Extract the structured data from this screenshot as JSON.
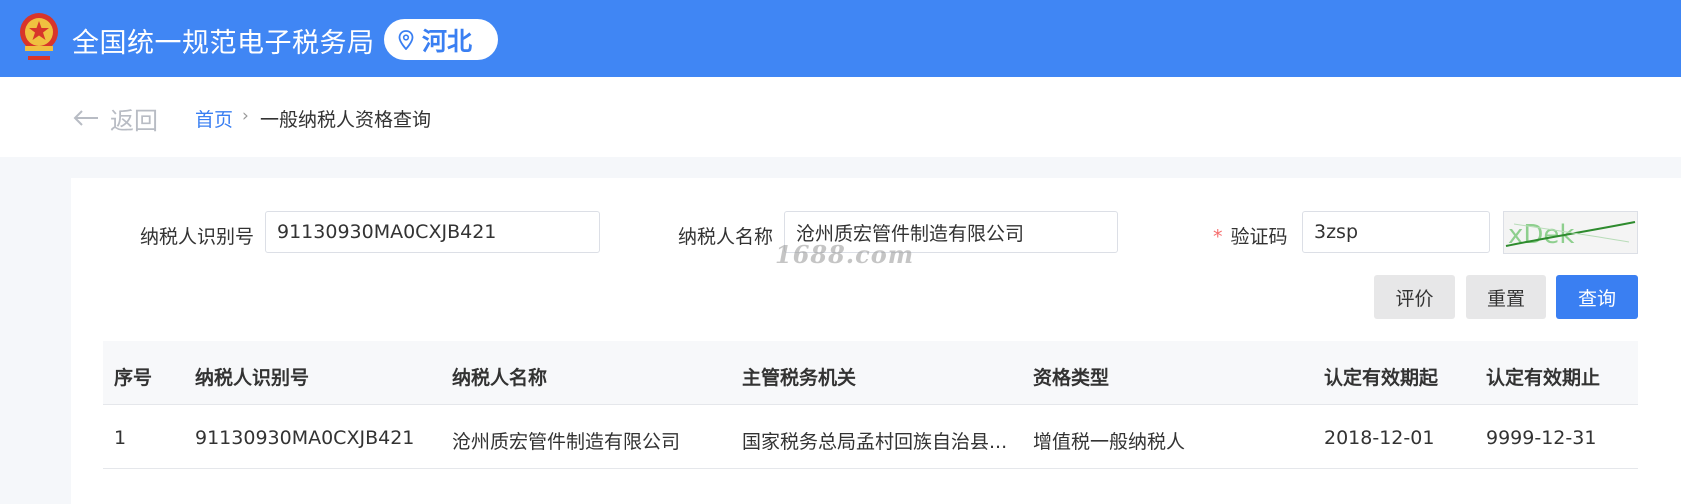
{
  "header": {
    "site_title": "全国统一规范电子税务局",
    "region": "河北",
    "colors": {
      "bar": "#4086f4",
      "accent": "#3a7ff2"
    }
  },
  "nav": {
    "back_label": "返回",
    "breadcrumb": [
      {
        "label": "首页"
      },
      {
        "label": "一般纳税人资格查询"
      }
    ],
    "separator": "›"
  },
  "form": {
    "taxpayer_id": {
      "label": "纳税人识别号",
      "value": "91130930MA0CXJB421"
    },
    "taxpayer_name": {
      "label": "纳税人名称",
      "value": "沧州质宏管件制造有限公司"
    },
    "captcha": {
      "required_mark": "*",
      "label": "验证码",
      "value": "3zsp",
      "image_text": "xDek"
    },
    "buttons": {
      "evaluate": "评价",
      "reset": "重置",
      "query": "查询"
    }
  },
  "watermark": "1688.com",
  "table": {
    "columns": [
      "序号",
      "纳税人识别号",
      "纳税人名称",
      "主管税务机关",
      "资格类型",
      "认定有效期起",
      "认定有效期止"
    ],
    "rows": [
      [
        "1",
        "91130930MA0CXJB421",
        "沧州质宏管件制造有限公司",
        "国家税务总局孟村回族自治县...",
        "增值税一般纳税人",
        "2018-12-01",
        "9999-12-31"
      ]
    ]
  }
}
